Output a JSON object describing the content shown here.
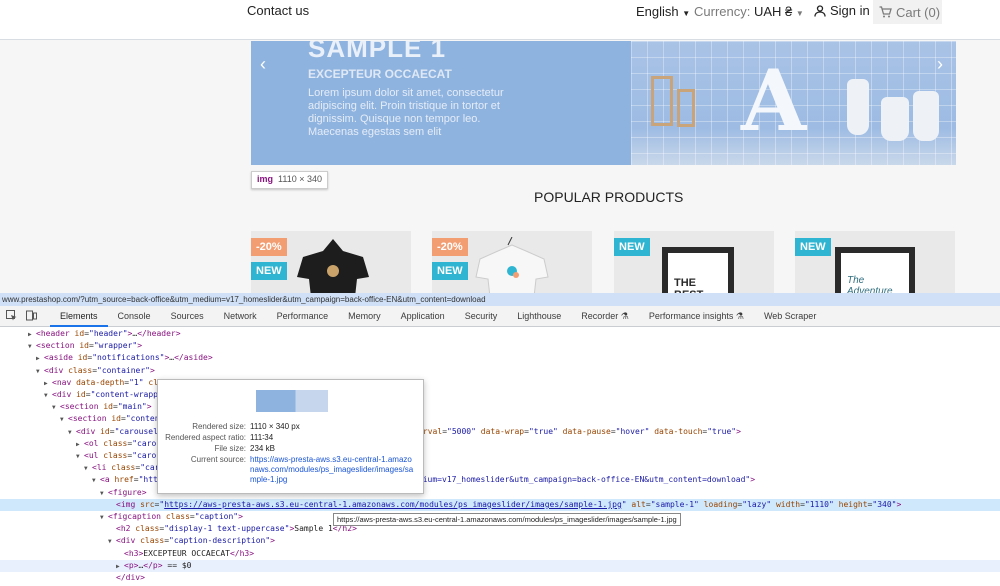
{
  "header": {
    "contact": "Contact us",
    "language": "English",
    "currency_label": "Currency:",
    "currency_value": "UAH ₴",
    "signin": "Sign in",
    "cart": "Cart (0)",
    "icons": [
      "user-icon",
      "cart-icon",
      "chevron-down-icon"
    ]
  },
  "slider": {
    "title": "SAMPLE 1",
    "subtitle": "EXCEPTEUR OCCAECAT",
    "text": "Lorem ipsum dolor sit amet, consectetur adipiscing elit. Proin tristique in tortor et dignissim. Quisque non tempor leo. Maecenas egestas sem elit",
    "prev": "‹",
    "next": "›",
    "letter": "A"
  },
  "img_tooltip": {
    "tag": "img",
    "size": "1110 × 340"
  },
  "popular_title": "POPULAR PRODUCTS",
  "products": [
    {
      "discount": "-20%",
      "badge": "NEW",
      "shirt_color": "#1d1d1d"
    },
    {
      "discount": "-20%",
      "badge": "NEW",
      "shirt_color": "#f7f7f7"
    },
    {
      "badge": "NEW",
      "poster": "THE BEST"
    },
    {
      "badge": "NEW",
      "poster": "The Adventure"
    }
  ],
  "devtools": {
    "status_url": "www.prestashop.com/?utm_source=back-office&utm_medium=v17_homeslider&utm_campaign=back-office-EN&utm_content=download",
    "tabs": [
      "Elements",
      "Console",
      "Sources",
      "Network",
      "Performance",
      "Memory",
      "Application",
      "Security",
      "Lighthouse",
      "Recorder ⚗",
      "Performance insights ⚗",
      "Web Scraper"
    ],
    "active_tab": "Elements",
    "lines": [
      {
        "indent": 3,
        "tri": "▶",
        "html": "<span class='tg'>&lt;header</span> <span class='at'>id</span>=<span class='av'>\"header\"</span><span class='tg'>&gt;</span>…<span class='tg'>&lt;/header&gt;</span>"
      },
      {
        "indent": 3,
        "tri": "▼",
        "html": "<span class='tg'>&lt;section</span> <span class='at'>id</span>=<span class='av'>\"wrapper\"</span><span class='tg'>&gt;</span>"
      },
      {
        "indent": 4,
        "tri": "▶",
        "html": "<span class='tg'>&lt;aside</span> <span class='at'>id</span>=<span class='av'>\"notifications\"</span><span class='tg'>&gt;</span>…<span class='tg'>&lt;/aside&gt;</span>"
      },
      {
        "indent": 4,
        "tri": "▼",
        "html": "<span class='tg'>&lt;div</span> <span class='at'>class</span>=<span class='av'>\"container\"</span><span class='tg'>&gt;</span>"
      },
      {
        "indent": 5,
        "tri": "▶",
        "html": "<span class='tg'>&lt;nav</span> <span class='at'>data-depth</span>=<span class='av'>\"1\"</span> <span class='at'>class</span>=<span class='av'>\"breadcrumb hidden-sm-down\"</span><span class='tg'>&gt;</span>…<span class='tg'>&lt;/nav&gt;</span>"
      },
      {
        "indent": 5,
        "tri": "▼",
        "html": "<span class='tg'>&lt;div</span> <span class='at'>id</span>=<span class='av'>\"content-wrapper\"</span><span class='tg'>&gt;</span>"
      },
      {
        "indent": 6,
        "tri": "▼",
        "html": "<span class='tg'>&lt;section</span> <span class='at'>id</span>=<span class='av'>\"main\"</span><span class='tg'>&gt;</span>"
      },
      {
        "indent": 7,
        "tri": "▼",
        "html": "<span class='tg'>&lt;section</span> <span class='at'>id</span>=<span class='av'>\"content\"</span><span class='tg'>&gt;</span>"
      },
      {
        "indent": 8,
        "tri": "▼",
        "html": "<span class='tg'>&lt;div</span> <span class='at'>id</span>=<span class='av'>\"carousel\"</span> <span class='at'>data-ride</span>=<span class='av'>\"carousel\"</span> <span class='at'>class</span>=<span class='av'>\"carousel slide\"</span> <span class='at'>data-interval</span>=<span class='av'>\"5000\"</span> <span class='at'>data-wrap</span>=<span class='av'>\"true\"</span> <span class='at'>data-pause</span>=<span class='av'>\"hover\"</span> <span class='at'>data-touch</span>=<span class='av'>\"true\"</span><span class='tg'>&gt;</span>"
      },
      {
        "indent": 9,
        "tri": "▶",
        "html": "<span class='tg'>&lt;ol</span> <span class='at'>class</span>=<span class='av'>\"carousel-indicators\"</span><span class='tg'>&gt;</span>…<span class='tg'>&lt;/ol&gt;</span>"
      },
      {
        "indent": 9,
        "tri": "▼",
        "html": "<span class='tg'>&lt;ul</span> <span class='at'>class</span>=<span class='av'>\"carousel-inner\"</span> <span class='at'>role</span>=<span class='av'>\"listbox\"</span><span class='tg'>&gt;</span>"
      },
      {
        "indent": 10,
        "tri": "▼",
        "html": "<span class='tg'>&lt;li</span> <span class='at'>class</span>=<span class='av'>\"carousel-item active\"</span> <span class='at'>role</span>=<span class='av'>\"option\"</span><span class='tg'>&gt;</span>"
      },
      {
        "indent": 11,
        "tri": "▼",
        "html": "<span class='tg'>&lt;a</span> <span class='at'>href</span>=<span class='av'>\"https://www.prestashop.com/?utm_source=back-office&amp;utm_medium=v17_homeslider&amp;utm_campaign=back-office-EN&amp;utm_content=download\"</span><span class='tg'>&gt;</span>"
      },
      {
        "indent": 12,
        "tri": "▼",
        "html": "<span class='tg'>&lt;figure&gt;</span>"
      },
      {
        "indent": 13,
        "tri": "",
        "sel": true,
        "html": "<span class='tg'>&lt;img</span> <span class='at'>src</span>=<span class='av'>\"</span><span class='lk'>https://aws-presta-aws.s3.eu-central-1.amazonaws.com/modules/ps_imageslider/images/sample-1.jpg</span><span class='av'>\"</span> <span class='at'>alt</span>=<span class='av'>\"sample-1\"</span> <span class='at'>loading</span>=<span class='av'>\"lazy\"</span> <span class='at'>width</span>=<span class='av'>\"1110\"</span> <span class='at'>height</span>=<span class='av'>\"340\"</span><span class='tg'>&gt;</span>"
      },
      {
        "indent": 12,
        "tri": "▼",
        "html": "<span class='tg'>&lt;figcaption</span> <span class='at'>class</span>=<span class='av'>\"caption\"</span><span class='tg'>&gt;</span>"
      },
      {
        "indent": 13,
        "tri": "",
        "html": "<span class='tg'>&lt;h2</span> <span class='at'>class</span>=<span class='av'>\"display-1 text-uppercase\"</span><span class='tg'>&gt;</span><span class='tx'>Sample 1</span><span class='tg'>&lt;/h2&gt;</span>"
      },
      {
        "indent": 13,
        "tri": "▼",
        "html": "<span class='tg'>&lt;div</span> <span class='at'>class</span>=<span class='av'>\"caption-description\"</span><span class='tg'>&gt;</span>"
      },
      {
        "indent": 14,
        "tri": "",
        "html": "<span class='tg'>&lt;h3&gt;</span><span class='tx'>EXCEPTEUR OCCAECAT</span><span class='tg'>&lt;/h3&gt;</span>"
      },
      {
        "indent": 14,
        "tri": "▶",
        "hov": true,
        "html": "<span class='tg'>&lt;p&gt;</span>…<span class='tg'>&lt;/p&gt;</span> <span class='tx'>== $0</span>"
      },
      {
        "indent": 13,
        "tri": "",
        "html": "<span class='tg'>&lt;/div&gt;</span>"
      },
      {
        "indent": 12,
        "tri": "",
        "html": "<span class='tg'>&lt;/figcaption&gt;</span>"
      }
    ],
    "hovercard": {
      "rendered_size_label": "Rendered size:",
      "rendered_size": "1110 × 340 px",
      "aspect_label": "Rendered aspect ratio:",
      "aspect": "111∶34",
      "file_size_label": "File size:",
      "file_size": "234 kB",
      "source_label": "Current source:",
      "source": "https://aws-presta-aws.s3.eu-central-1.amazonaws.com/modules/ps_imageslider/images/sample-1.jpg"
    },
    "url_tooltip": "https://aws-presta-aws.s3.eu-central-1.amazonaws.com/modules/ps_imageslider/images/sample-1.jpg"
  }
}
